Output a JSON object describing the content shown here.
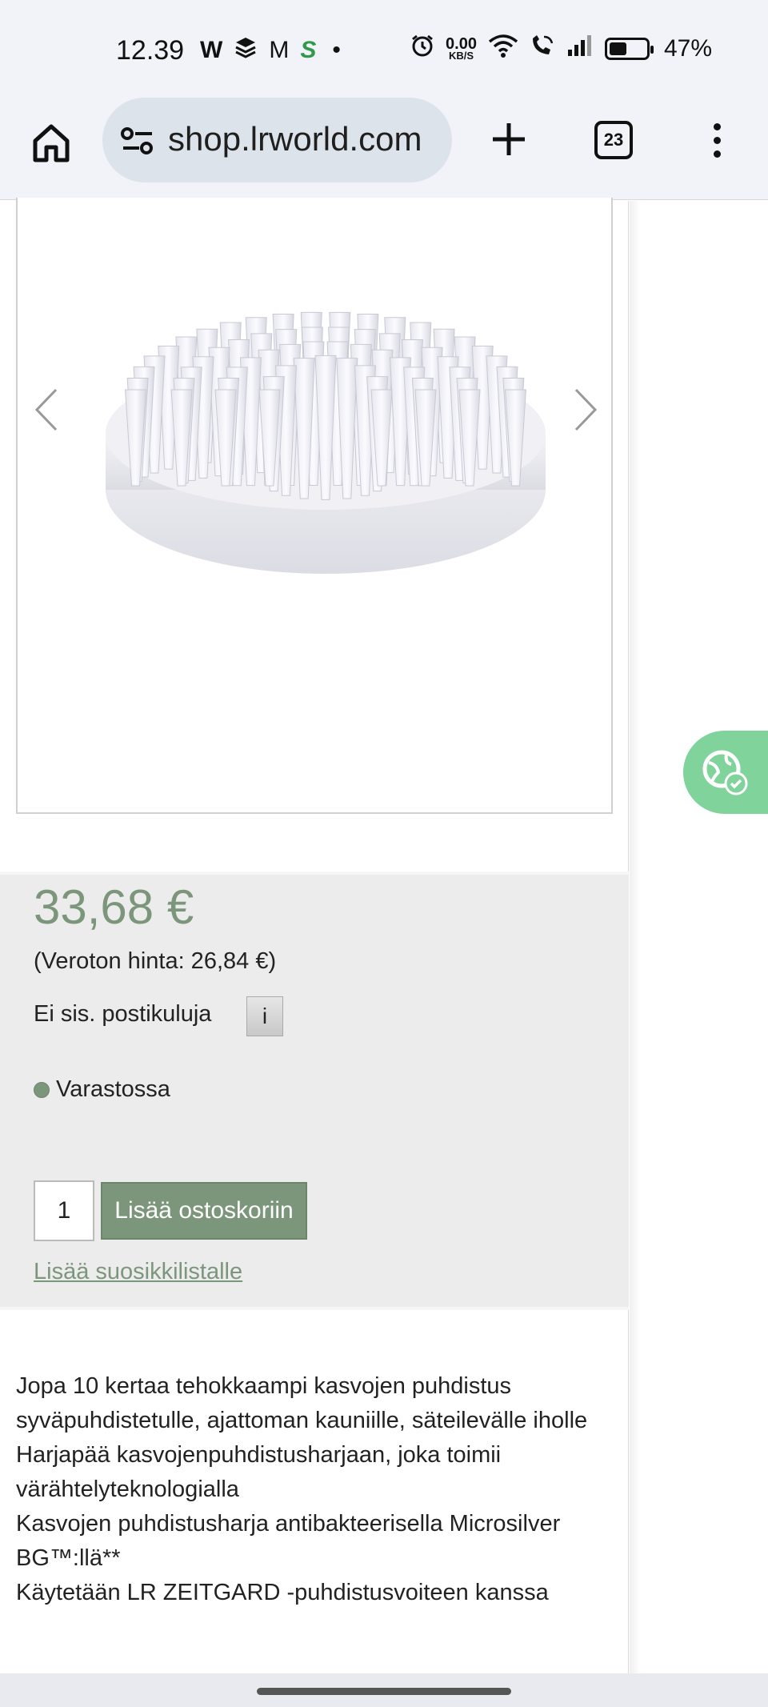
{
  "status_bar": {
    "time": "12.39",
    "left_icons": [
      "W",
      "layers-icon",
      "M",
      "S"
    ],
    "dot": "•",
    "network_speed_value": "0.00",
    "network_speed_unit": "KB/S",
    "battery_percent": "47%",
    "battery_level": 0.47
  },
  "browser": {
    "url": "shop.lrworld.com",
    "tab_count": "23"
  },
  "product": {
    "price": "33,68 €",
    "net_price": "(Veroton hinta: 26,84 €)",
    "shipping": "Ei sis. postikuluja",
    "info_label": "i",
    "stock": "Varastossa",
    "quantity": "1",
    "add_to_cart": "Lisää ostoskoriin",
    "wishlist": "Lisää suosikkilistalle",
    "description": [
      "Jopa 10 kertaa tehokkaampi kasvojen puhdistus syväpuhdistetulle, ajattoman kauniille, säteilevälle iholle",
      "Harjapää kasvojenpuhdistusharjaan, joka toimii värähtelyteknologialla",
      "Kasvojen puhdistusharja antibakteerisella Microsilver BG™:llä**",
      "Käytetään LR ZEITGARD -puhdistusvoiteen kanssa"
    ]
  },
  "colors": {
    "accent_green": "#7c967c",
    "widget_green": "#7fd39b",
    "price_box_bg": "#ececec"
  }
}
